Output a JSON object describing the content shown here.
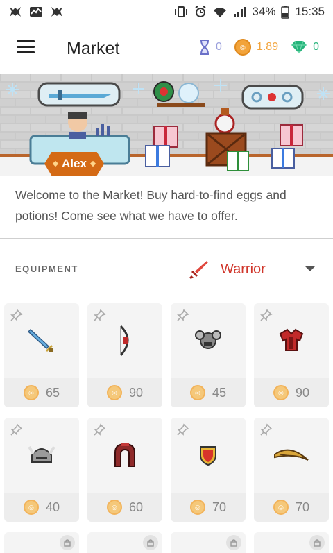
{
  "status_bar": {
    "battery": "34%",
    "time": "15:35",
    "left_icons": [
      "app-icon-1",
      "app-icon-2",
      "app-icon-3"
    ],
    "right_icons": [
      "vibrate-icon",
      "alarm-icon",
      "wifi-icon",
      "signal-icon",
      "battery-icon"
    ]
  },
  "app_bar": {
    "title": "Market",
    "currencies": {
      "hourglass": "0",
      "gold": "1.89",
      "gems": "0"
    }
  },
  "banner": {
    "npc_name": "Alex"
  },
  "welcome_text": "Welcome to the Market! Buy hard-to-find eggs and potions! Come see what we have to offer.",
  "section": {
    "label": "EQUIPMENT",
    "class_selected": "Warrior"
  },
  "items": [
    {
      "name": "sword",
      "price": "65"
    },
    {
      "name": "bow",
      "price": "90"
    },
    {
      "name": "helm-silver",
      "price": "45"
    },
    {
      "name": "armor-red",
      "price": "90"
    },
    {
      "name": "helm-viking",
      "price": "40"
    },
    {
      "name": "hood-red",
      "price": "60"
    },
    {
      "name": "shield-red",
      "price": "70"
    },
    {
      "name": "bow-golden",
      "price": "70"
    }
  ],
  "colors": {
    "accent_red": "#d0362b",
    "gold": "#f2a33a",
    "gem": "#25b37a",
    "hourglass": "#9a9fdc",
    "npc_tag": "#d46a15"
  }
}
